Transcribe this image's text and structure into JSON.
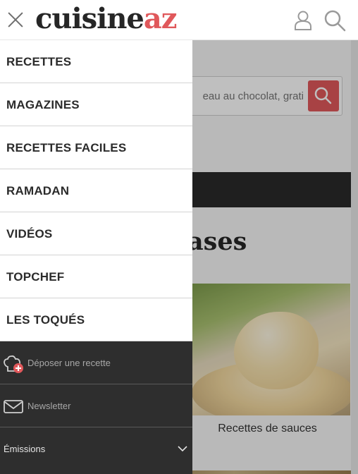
{
  "header": {
    "logo_part1": "cuisine",
    "logo_part2": "az",
    "brand_color": "#e0585b"
  },
  "background": {
    "search_placeholder": "eau au chocolat, grati",
    "section_title": "ases",
    "card_label": "Recettes de sauces"
  },
  "menu": {
    "items": [
      {
        "label": "RECETTES"
      },
      {
        "label": "MAGAZINES"
      },
      {
        "label": "RECETTES FACILES"
      },
      {
        "label": "RAMADAN"
      },
      {
        "label": "VIDÉOS"
      },
      {
        "label": "TOPCHEF"
      },
      {
        "label": "LES TOQUÉS"
      }
    ],
    "secondary": {
      "submit_recipe": "Déposer une recette",
      "newsletter": "Newsletter",
      "emissions": "Émissions"
    }
  },
  "icons": [
    "close-icon",
    "user-icon",
    "search-icon",
    "chef-hat-add-icon",
    "envelope-icon",
    "chevron-down-icon"
  ]
}
